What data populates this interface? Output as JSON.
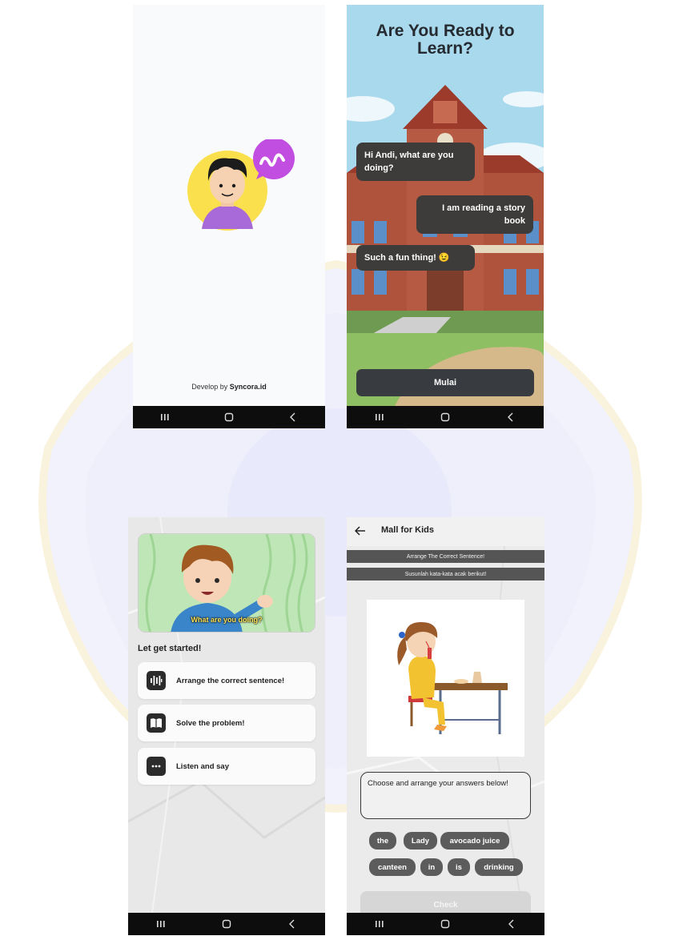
{
  "splash": {
    "develop_prefix": "Develop by ",
    "develop_brand": "Syncora.id"
  },
  "intro": {
    "title": "Are You Ready to Learn?",
    "bubble_1": "Hi Andi, what are you doing?",
    "bubble_2": "I am reading a story book",
    "bubble_3": "Such a fun thing! 😉",
    "start_button": "Mulai"
  },
  "menu": {
    "video_subtitle": "What are you doing?",
    "heading": "Let get started!",
    "items": [
      {
        "label": "Arrange the correct sentence!",
        "icon": "waveform-icon"
      },
      {
        "label": "Solve the problem!",
        "icon": "book-icon"
      },
      {
        "label": "Listen and say",
        "icon": "chat-dots-icon"
      }
    ]
  },
  "exercise": {
    "title": "Mall for Kids",
    "instruction_en": "Arrange The Correct Sentence!",
    "instruction_id": "Susunlah kata-kata acak berikut!",
    "answer_prompt": "Choose and arrange your answers below!",
    "words_row1": [
      "the",
      "Lady",
      "avocado juice"
    ],
    "words_row2": [
      "canteen",
      "in",
      "is",
      "drinking"
    ],
    "check_button": "Check"
  },
  "colors": {
    "dark_bubble": "#3d3c3b",
    "brand_purple": "#c14ee0",
    "avatar_yellow": "#fbe04e"
  }
}
